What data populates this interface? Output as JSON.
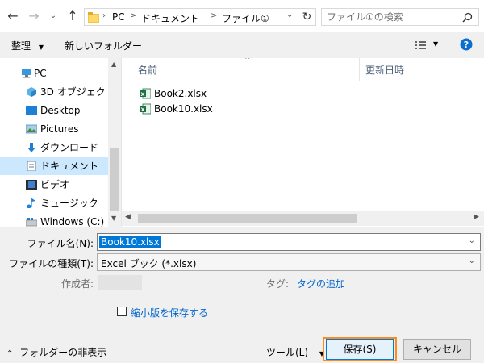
{
  "address": {
    "crumbs": [
      "PC",
      "ドキュメント",
      "ファイル①"
    ],
    "separator": ">"
  },
  "search": {
    "placeholder": "ファイル①の検索"
  },
  "toolbar": {
    "organize_label": "整理",
    "new_folder_label": "新しいフォルダー"
  },
  "nav": {
    "items": [
      {
        "label": "PC",
        "icon": "pc-icon"
      },
      {
        "label": "3D オブジェクト",
        "icon": "3d-objects-icon"
      },
      {
        "label": "Desktop",
        "icon": "desktop-icon"
      },
      {
        "label": "Pictures",
        "icon": "pictures-icon"
      },
      {
        "label": "ダウンロード",
        "icon": "download-icon"
      },
      {
        "label": "ドキュメント",
        "icon": "documents-icon"
      },
      {
        "label": "ビデオ",
        "icon": "video-icon"
      },
      {
        "label": "ミュージック",
        "icon": "music-icon"
      },
      {
        "label": "Windows (C:)",
        "icon": "drive-icon"
      }
    ],
    "selected_index": 5
  },
  "files": {
    "columns": [
      "名前",
      "更新日時"
    ],
    "items": [
      {
        "name": "Book2.xlsx",
        "icon": "excel-file-icon"
      },
      {
        "name": "Book10.xlsx",
        "icon": "excel-file-icon"
      }
    ]
  },
  "form": {
    "filename_label": "ファイル名(N):",
    "filename_value": "Book10.xlsx",
    "filetype_label": "ファイルの種類(T):",
    "filetype_value": "Excel ブック (*.xlsx)",
    "author_label": "作成者:",
    "tags_label": "タグ:",
    "tags_link": "タグの追加",
    "thumbnail_label": "縮小版を保存する",
    "thumbnail_checked": false
  },
  "footer": {
    "hide_folders_label": "フォルダーの非表示",
    "tools_label": "ツール(L)",
    "save_label": "保存(S)",
    "cancel_label": "キャンセル"
  },
  "colors": {
    "accent": "#0078d7",
    "selection": "#cce8ff",
    "save_highlight": "#ff8c1a",
    "link": "#0066cc"
  }
}
